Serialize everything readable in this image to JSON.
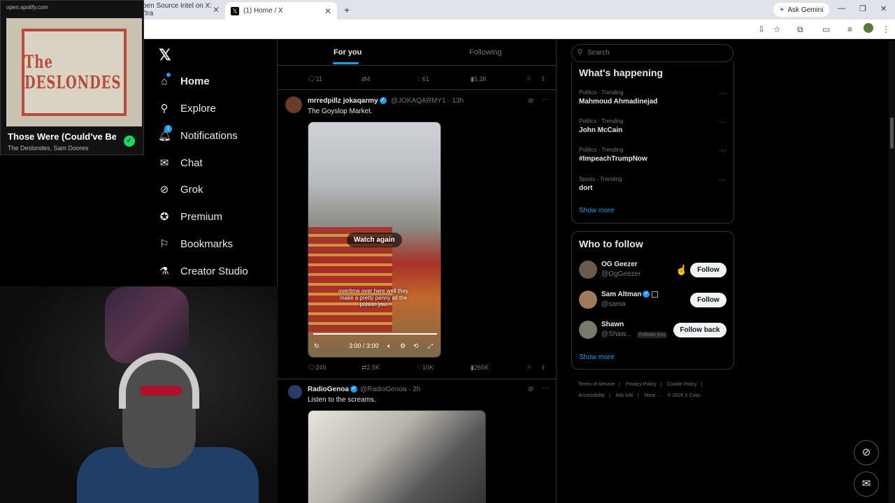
{
  "browser": {
    "tabs": [
      {
        "label": "pen Source Intel on X: \"Ira"
      },
      {
        "label": "(1) Home / X",
        "icon": "x-logo-icon"
      }
    ],
    "new_tab": "+",
    "ask_gemini": "Ask Gemini",
    "window_controls": [
      "—",
      "❐",
      "✕"
    ]
  },
  "spotify": {
    "url": "open.spotify.com",
    "cover_text": "The DESLONDES",
    "title": "Those Were (Could've Been)",
    "artist": "The Deslondes, Sam Doores"
  },
  "nav": {
    "logo": "𝕏",
    "notifications_badge": "1",
    "items": [
      {
        "label": "Home",
        "icon": "home-icon"
      },
      {
        "label": "Explore",
        "icon": "search-icon"
      },
      {
        "label": "Notifications",
        "icon": "bell-icon"
      },
      {
        "label": "Chat",
        "icon": "mail-icon"
      },
      {
        "label": "Grok",
        "icon": "grok-icon"
      },
      {
        "label": "Premium",
        "icon": "premium-icon"
      },
      {
        "label": "Bookmarks",
        "icon": "bookmark-icon"
      },
      {
        "label": "Creator Studio",
        "icon": "flask-icon"
      }
    ]
  },
  "feed": {
    "tabs": [
      {
        "label": "For you"
      },
      {
        "label": "Following"
      }
    ],
    "top_actions": {
      "replies": "11",
      "reposts": "4",
      "likes": "61",
      "views": "5.2K"
    },
    "posts": [
      {
        "name": "mrredpillz jokaqarmy",
        "handle": "@JOKAQARMY1 · 13h",
        "text": "The Goyslop Market.",
        "video": {
          "watch_again": "Watch again",
          "caption": "overtime over here well they make a pretty penny all the poison you",
          "time": "3:00 / 3:00"
        },
        "actions": {
          "replies": "249",
          "reposts": "2.5K",
          "likes": "10K",
          "views": "265K"
        }
      },
      {
        "name": "RadioGenoa",
        "handle": "@RadioGenoa · 2h",
        "text": "Listen to the screams."
      }
    ]
  },
  "right": {
    "search_placeholder": "Search",
    "whats_happening": {
      "title": "What's happening",
      "trends": [
        {
          "category": "Politics · Trending",
          "name": "Mahmoud Ahmadinejad"
        },
        {
          "category": "Politics · Trending",
          "name": "John McCain"
        },
        {
          "category": "Politics · Trending",
          "name": "#ImpeachTrumpNow"
        },
        {
          "category": "Sports · Trending",
          "name": "dort"
        }
      ],
      "show_more": "Show more"
    },
    "who_to_follow": {
      "title": "Who to follow",
      "accounts": [
        {
          "name": "OG Geezer",
          "handle": "@OgGeezer",
          "button": "Follow"
        },
        {
          "name": "Sam Altman",
          "handle": "@sama",
          "button": "Follow"
        },
        {
          "name": "Shawn",
          "handle": "@Shaw...",
          "badge": "Follows you",
          "button": "Follow back"
        }
      ],
      "show_more": "Show more"
    },
    "footer": [
      "Terms of Service",
      "|",
      "Privacy Policy",
      "|",
      "Cookie Policy",
      "|",
      "Accessibility",
      "|",
      "Ads info",
      "|",
      "More ···",
      "© 2026 X Corp."
    ]
  }
}
